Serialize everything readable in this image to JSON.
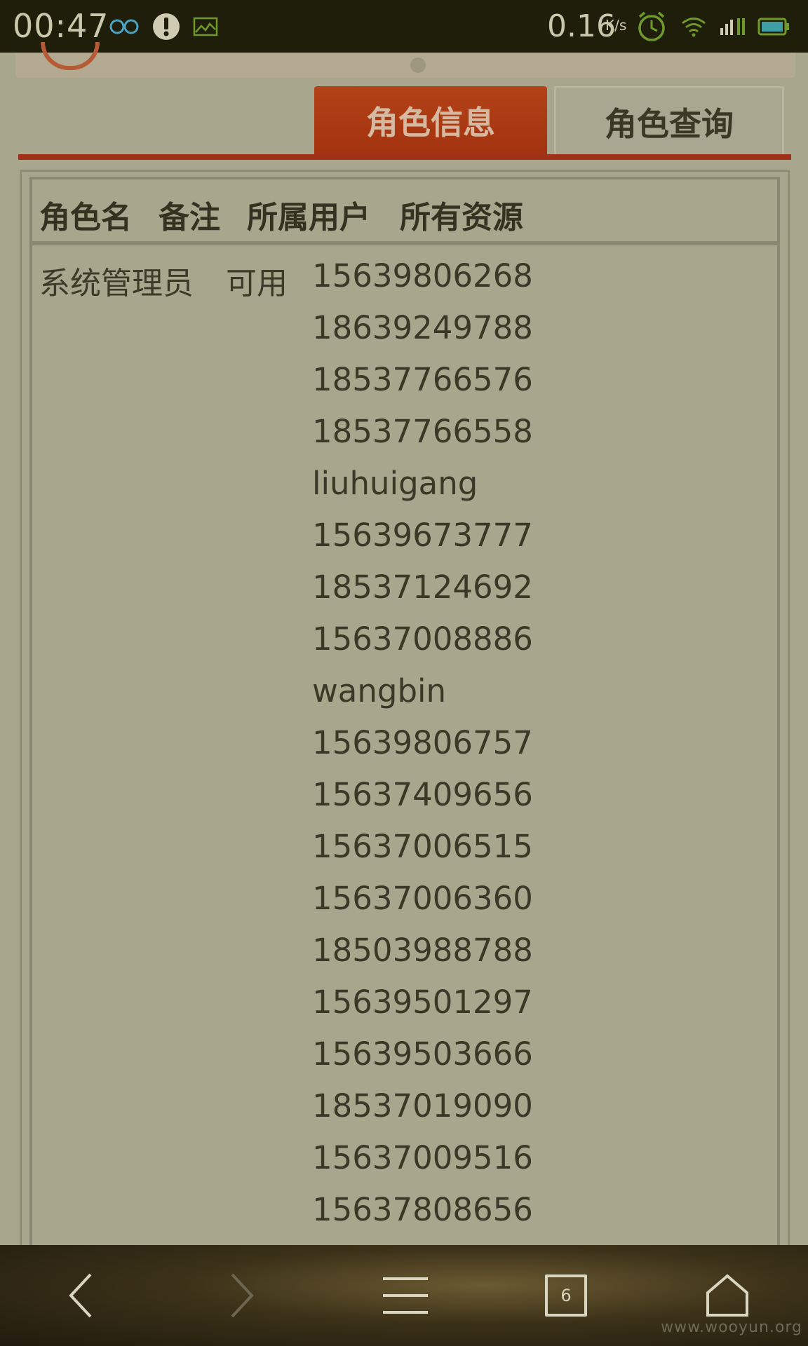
{
  "status_bar": {
    "time": "00:47",
    "speed": "0.16",
    "speed_unit": "K/s",
    "icons": [
      "infinity-icon",
      "alert-icon",
      "image-icon",
      "alarm-icon",
      "wifi-icon",
      "signal-icon",
      "battery-icon"
    ]
  },
  "tabs": [
    {
      "label": "角色信息",
      "active": true
    },
    {
      "label": "角色查询",
      "active": false
    }
  ],
  "table": {
    "headers": [
      "角色名",
      "备注",
      "所属用户",
      "所有资源"
    ],
    "row": {
      "role_name": "系统管理员",
      "note": "可用",
      "users": [
        "15639806268",
        "18639249788",
        "18537766576",
        "18537766558",
        "liuhuigang",
        "15639673777",
        "18537124692",
        "15637008886",
        "wangbin",
        "15639806757",
        "15637409656",
        "15637006515",
        "15637006360",
        "18503988788",
        "15639501297",
        "15639503666",
        "18537019090",
        "15637009516",
        "15637808656"
      ]
    }
  },
  "bottom_nav": {
    "tab_count": "6",
    "watermark": "www.wooyun.org"
  },
  "colors": {
    "status_bg": "#1f1e0b",
    "page_bg": "#a8a68d",
    "accent": "#a13018",
    "signal_green": "#6f9a2a"
  }
}
